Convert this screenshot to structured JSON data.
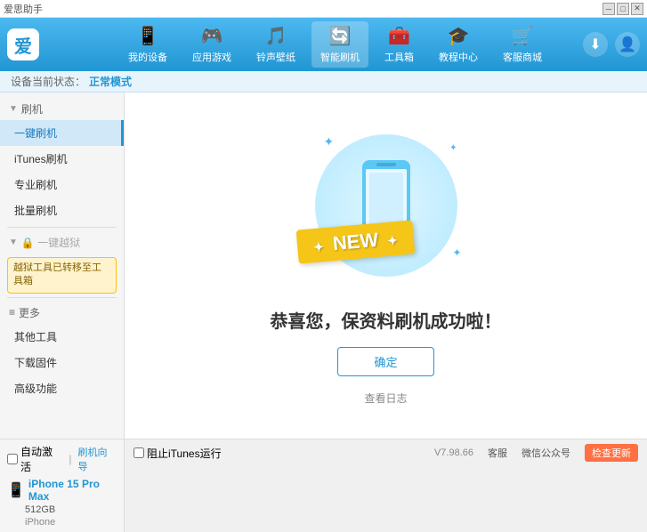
{
  "titleBar": {
    "title": "爱思助手",
    "winButtons": [
      "─",
      "□",
      "✕"
    ]
  },
  "topNav": {
    "logo": "爱思助手",
    "logoChar": "爱",
    "items": [
      {
        "id": "my-device",
        "icon": "📱",
        "label": "我的设备"
      },
      {
        "id": "app-game",
        "icon": "🎮",
        "label": "应用游戏"
      },
      {
        "id": "ringtone-wallpaper",
        "icon": "🎵",
        "label": "铃声壁纸"
      },
      {
        "id": "smart-flash",
        "icon": "🔄",
        "label": "智能刷机"
      },
      {
        "id": "toolbox",
        "icon": "🧰",
        "label": "工具箱"
      },
      {
        "id": "tutorial",
        "icon": "🎓",
        "label": "教程中心"
      },
      {
        "id": "store",
        "icon": "🛒",
        "label": "客服商城"
      }
    ],
    "activeItem": "smart-flash",
    "downloadBtn": "⬇",
    "userBtn": "👤"
  },
  "statusBar": {
    "label": "设备当前状态：",
    "value": "正常模式"
  },
  "sidebar": {
    "flashSection": {
      "header": "刷机",
      "items": [
        {
          "id": "one-key-flash",
          "label": "一键刷机",
          "active": true
        },
        {
          "id": "itunes-flash",
          "label": "iTunes刷机",
          "active": false
        },
        {
          "id": "pro-flash",
          "label": "专业刷机",
          "active": false
        },
        {
          "id": "batch-flash",
          "label": "批量刷机",
          "active": false
        }
      ]
    },
    "jailbreakSection": {
      "header": "一键越狱",
      "locked": true,
      "note": "越狱工具已转移至\n工具箱"
    },
    "moreSection": {
      "header": "更多",
      "items": [
        {
          "id": "other-tools",
          "label": "其他工具"
        },
        {
          "id": "download-firmware",
          "label": "下载固件"
        },
        {
          "id": "advanced",
          "label": "高级功能"
        }
      ]
    }
  },
  "mainContent": {
    "circleColor": "#c8eefa",
    "phoneColor": "#5bc8f5",
    "newBadgeText": "NEW",
    "successTitle": "恭喜您，保资料刷机成功啦！",
    "confirmBtn": "确定",
    "logLink": "查看日志"
  },
  "bottomBar": {
    "autoConnect": "自动激活",
    "guide": "刷机向导",
    "deviceName": "iPhone 15 Pro Max",
    "deviceStorage": "512GB",
    "deviceType": "iPhone",
    "version": "V7.98.66",
    "support": "客服",
    "wechat": "微信公众号",
    "update": "检查更新",
    "blockItunes": "阻止iTunes运行"
  }
}
